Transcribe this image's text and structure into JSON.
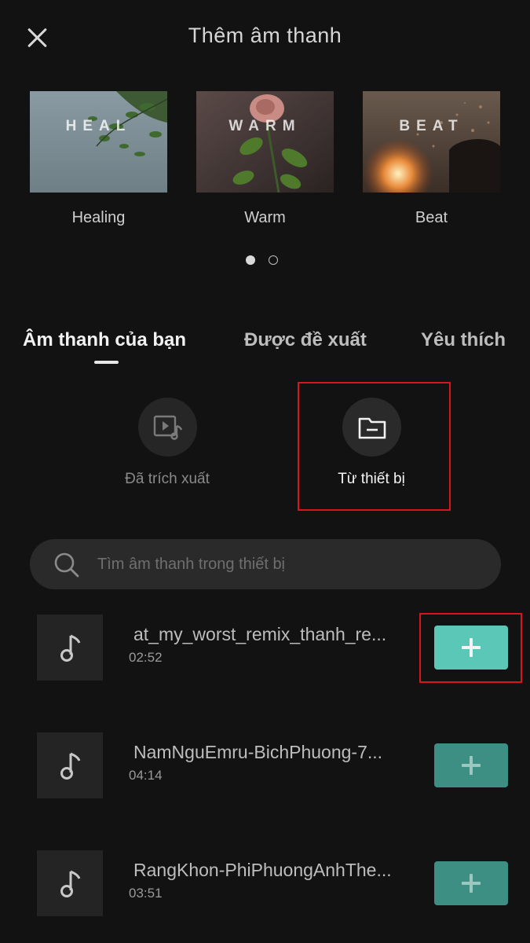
{
  "header": {
    "title": "Thêm âm thanh",
    "close_icon": "close-icon"
  },
  "categories": [
    {
      "overlay": "HEAL",
      "label": "Healing"
    },
    {
      "overlay": "WARM",
      "label": "Warm"
    },
    {
      "overlay": "BEAT",
      "label": "Beat"
    }
  ],
  "pager": {
    "pages": 2,
    "current": 1
  },
  "tabs": [
    {
      "label": "Âm thanh của bạn",
      "active": true
    },
    {
      "label": "Được đề xuất",
      "active": false
    },
    {
      "label": "Yêu thích",
      "active": false
    }
  ],
  "sources": {
    "extracted": {
      "label": "Đã trích xuất",
      "icon": "video-music-icon"
    },
    "device": {
      "label": "Từ thiết bị",
      "icon": "folder-icon"
    }
  },
  "search": {
    "placeholder": "Tìm âm thanh trong thiết bị",
    "value": ""
  },
  "tracks": [
    {
      "title": "at_my_worst_remix_thanh_re...",
      "duration": "02:52"
    },
    {
      "title": "NamNguEmru-BichPhuong-7...",
      "duration": "04:14"
    },
    {
      "title": "RangKhon-PhiPhuongAnhThe...",
      "duration": "03:51"
    }
  ],
  "colors": {
    "accent": "#5bc8b7",
    "highlight": "#d5171d",
    "background": "#121212"
  }
}
